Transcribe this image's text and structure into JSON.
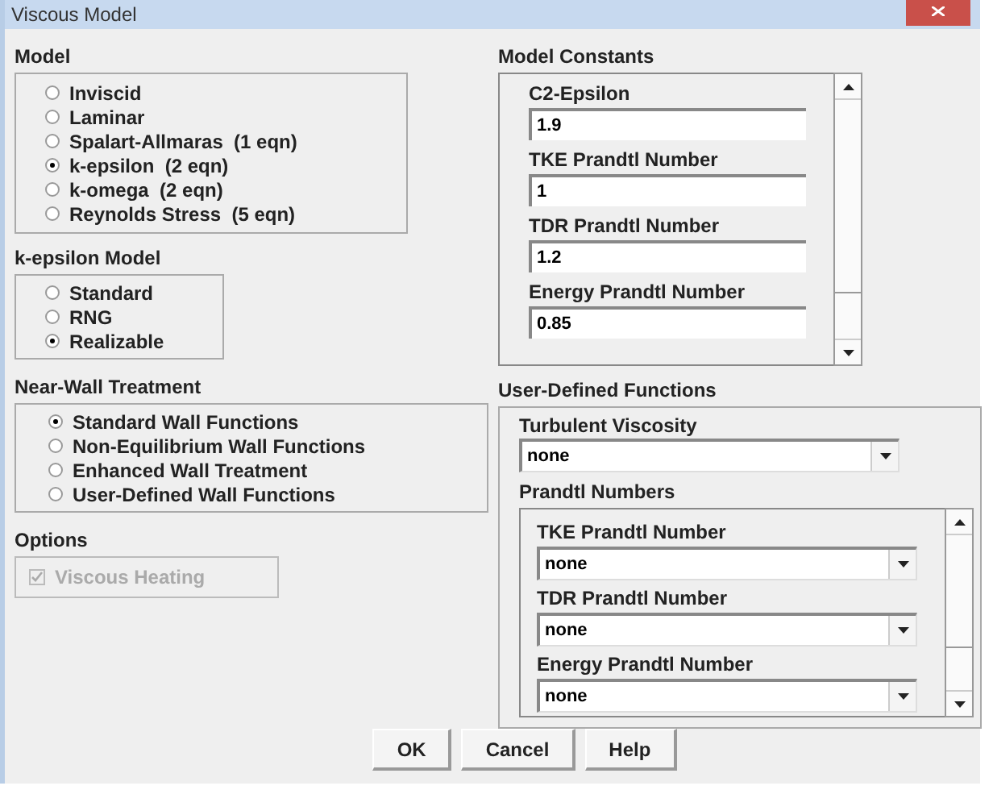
{
  "window": {
    "title": "Viscous Model"
  },
  "model": {
    "title": "Model",
    "options": [
      {
        "label": "Inviscid",
        "selected": false
      },
      {
        "label": "Laminar",
        "selected": false
      },
      {
        "label": "Spalart-Allmaras  (1 eqn)",
        "selected": false
      },
      {
        "label": "k-epsilon  (2 eqn)",
        "selected": true
      },
      {
        "label": "k-omega  (2 eqn)",
        "selected": false
      },
      {
        "label": "Reynolds Stress  (5 eqn)",
        "selected": false
      }
    ]
  },
  "k_epsilon_model": {
    "title": "k-epsilon Model",
    "options": [
      {
        "label": "Standard",
        "selected": false
      },
      {
        "label": "RNG",
        "selected": false
      },
      {
        "label": "Realizable",
        "selected": true
      }
    ]
  },
  "near_wall_treatment": {
    "title": "Near-Wall Treatment",
    "options": [
      {
        "label": "Standard Wall Functions",
        "selected": true
      },
      {
        "label": "Non-Equilibrium Wall Functions",
        "selected": false
      },
      {
        "label": "Enhanced Wall Treatment",
        "selected": false
      },
      {
        "label": "User-Defined Wall Functions",
        "selected": false
      }
    ]
  },
  "options": {
    "title": "Options",
    "items": [
      {
        "label": "Viscous Heating",
        "checked": true,
        "disabled": true
      }
    ]
  },
  "model_constants": {
    "title": "Model Constants",
    "fields": [
      {
        "label": "C2-Epsilon",
        "value": "1.9"
      },
      {
        "label": "TKE Prandtl Number",
        "value": "1"
      },
      {
        "label": "TDR Prandtl Number",
        "value": "1.2"
      },
      {
        "label": "Energy Prandtl Number",
        "value": "0.85"
      }
    ]
  },
  "user_defined_functions": {
    "title": "User-Defined Functions",
    "turbulent_viscosity": {
      "label": "Turbulent Viscosity",
      "value": "none"
    },
    "prandtl_numbers": {
      "title": "Prandtl Numbers",
      "fields": [
        {
          "label": "TKE Prandtl Number",
          "value": "none"
        },
        {
          "label": "TDR Prandtl Number",
          "value": "none"
        },
        {
          "label": "Energy Prandtl Number",
          "value": "none"
        }
      ]
    }
  },
  "buttons": [
    "OK",
    "Cancel",
    "Help"
  ]
}
